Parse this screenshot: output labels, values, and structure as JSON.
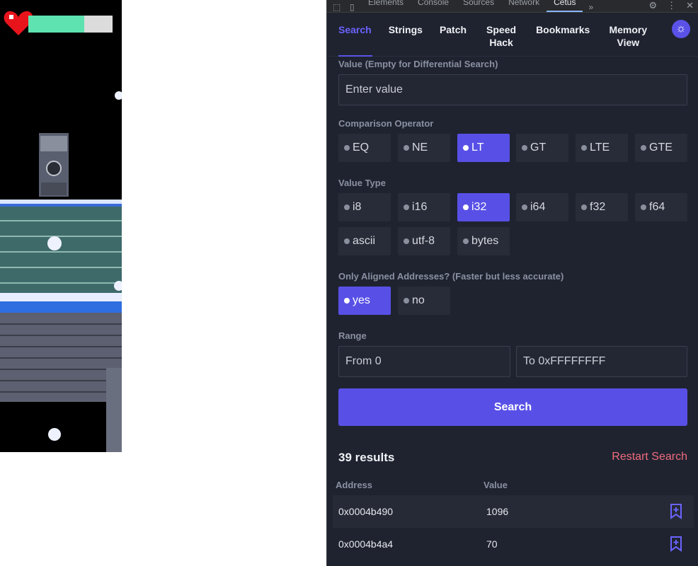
{
  "devtools_tabs": [
    "Elements",
    "Console",
    "Sources",
    "Network",
    "Cetus"
  ],
  "devtools_active_tab": "Cetus",
  "cetus_nav": [
    {
      "label": "Search"
    },
    {
      "label": "Strings"
    },
    {
      "label": "Patch"
    },
    {
      "label": "Speed Hack"
    },
    {
      "label": "Bookmarks"
    },
    {
      "label": "Memory View"
    }
  ],
  "active_nav": "Search",
  "value_section": {
    "label": "Value (Empty for Differential Search)",
    "placeholder": "Enter value"
  },
  "comparison": {
    "label": "Comparison Operator",
    "options": [
      "EQ",
      "NE",
      "LT",
      "GT",
      "LTE",
      "GTE"
    ],
    "selected": "LT"
  },
  "value_type": {
    "label": "Value Type",
    "options": [
      "i8",
      "i16",
      "i32",
      "i64",
      "f32",
      "f64",
      "ascii",
      "utf-8",
      "bytes"
    ],
    "selected": "i32"
  },
  "aligned": {
    "label": "Only Aligned Addresses? (Faster but less accurate)",
    "options": [
      "yes",
      "no"
    ],
    "selected": "yes"
  },
  "range": {
    "label": "Range",
    "from_placeholder": "From 0",
    "to_placeholder": "To 0xFFFFFFFF"
  },
  "search_button": "Search",
  "results": {
    "count_label": "39 results",
    "restart_label": "Restart Search",
    "columns": [
      "Address",
      "Value"
    ],
    "rows": [
      {
        "address": "0x0004b490",
        "value": "1096"
      },
      {
        "address": "0x0004b4a4",
        "value": "70"
      }
    ]
  },
  "game": {
    "health_fraction": 0.66
  },
  "colors": {
    "accent": "#5850e6",
    "danger": "#f06c7e",
    "panel_bg": "#1f2330",
    "health": "#5ee3b0",
    "heart": "#e8141c"
  }
}
